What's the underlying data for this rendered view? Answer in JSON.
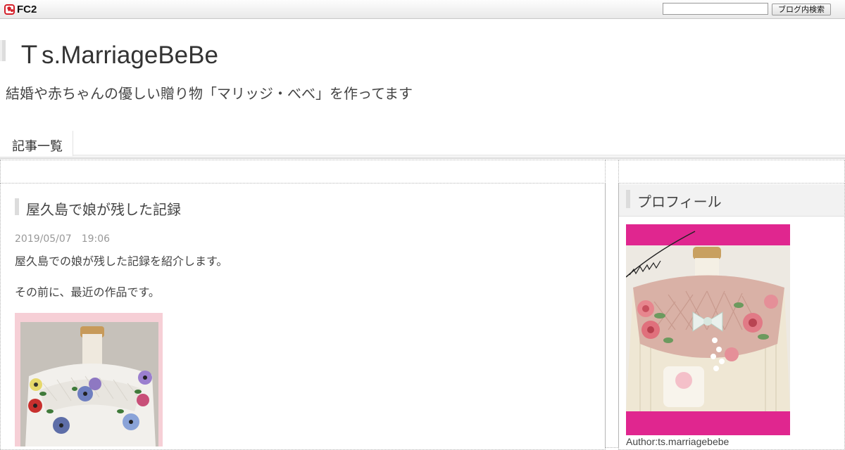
{
  "fc2": {
    "logo_text": "FC2",
    "search_placeholder": "",
    "search_button_label": "ブログ内検索"
  },
  "header": {
    "title": "Ｔs.MarriageBeBe",
    "description": "結婚や赤ちゃんの優しい贈り物「マリッジ・べべ」を作ってます"
  },
  "nav": {
    "items": [
      {
        "label": "記事一覧"
      }
    ]
  },
  "article": {
    "title": "屋久島で娘が残した記録",
    "date": "2019/05/07　19:06",
    "paragraphs": [
      "屋久島での娘が残した記録を紹介します。",
      "その前に、最近の作品です。"
    ]
  },
  "sidebar": {
    "profile_title": "プロフィール",
    "author": "Author:ts.marriagebebe"
  },
  "colors": {
    "accent_pink": "#e0268f",
    "photo_frame_pink": "#f6cfd6"
  }
}
